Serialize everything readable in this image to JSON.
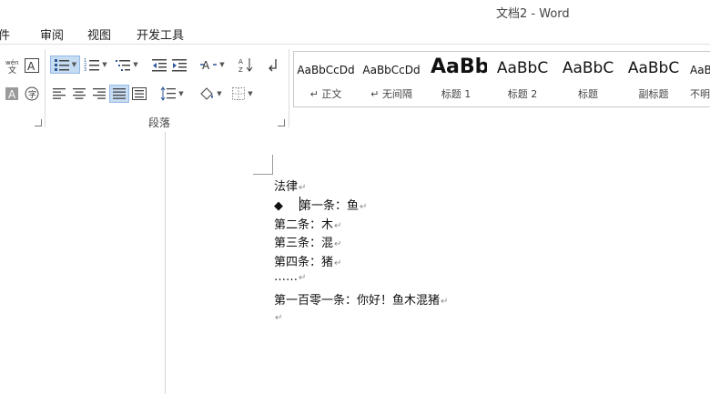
{
  "window": {
    "title": "文档2 - Word"
  },
  "menu": {
    "tabs": [
      "件",
      "审阅",
      "视图",
      "开发工具"
    ]
  },
  "ribbon": {
    "group_paragraph": "段落",
    "styles": [
      {
        "sample": "AaBbCcDd",
        "name": "↵ 正文"
      },
      {
        "sample": "AaBbCcDd",
        "name": "↵ 无间隔"
      },
      {
        "sample": "AaBb",
        "name": "标题 1"
      },
      {
        "sample": "AaBbC",
        "name": "标题 2"
      },
      {
        "sample": "AaBbC",
        "name": "标题"
      },
      {
        "sample": "AaBbC",
        "name": "副标题"
      },
      {
        "sample": "AaBl",
        "name": "不明"
      }
    ]
  },
  "document": {
    "lines": [
      {
        "text": "法律"
      },
      {
        "bullet": "◆",
        "text": "第一条：鱼"
      },
      {
        "text": "第二条：木"
      },
      {
        "text": "第三条：混"
      },
      {
        "text": "第四条：猪"
      },
      {
        "text": "……"
      },
      {
        "text": "第一百零一条：你好！鱼木混猪"
      },
      {
        "text": ""
      }
    ],
    "para_mark": "↵"
  },
  "colors": {
    "selected_button": "#c5dcf3",
    "ribbon_border": "#d5d5d5"
  }
}
